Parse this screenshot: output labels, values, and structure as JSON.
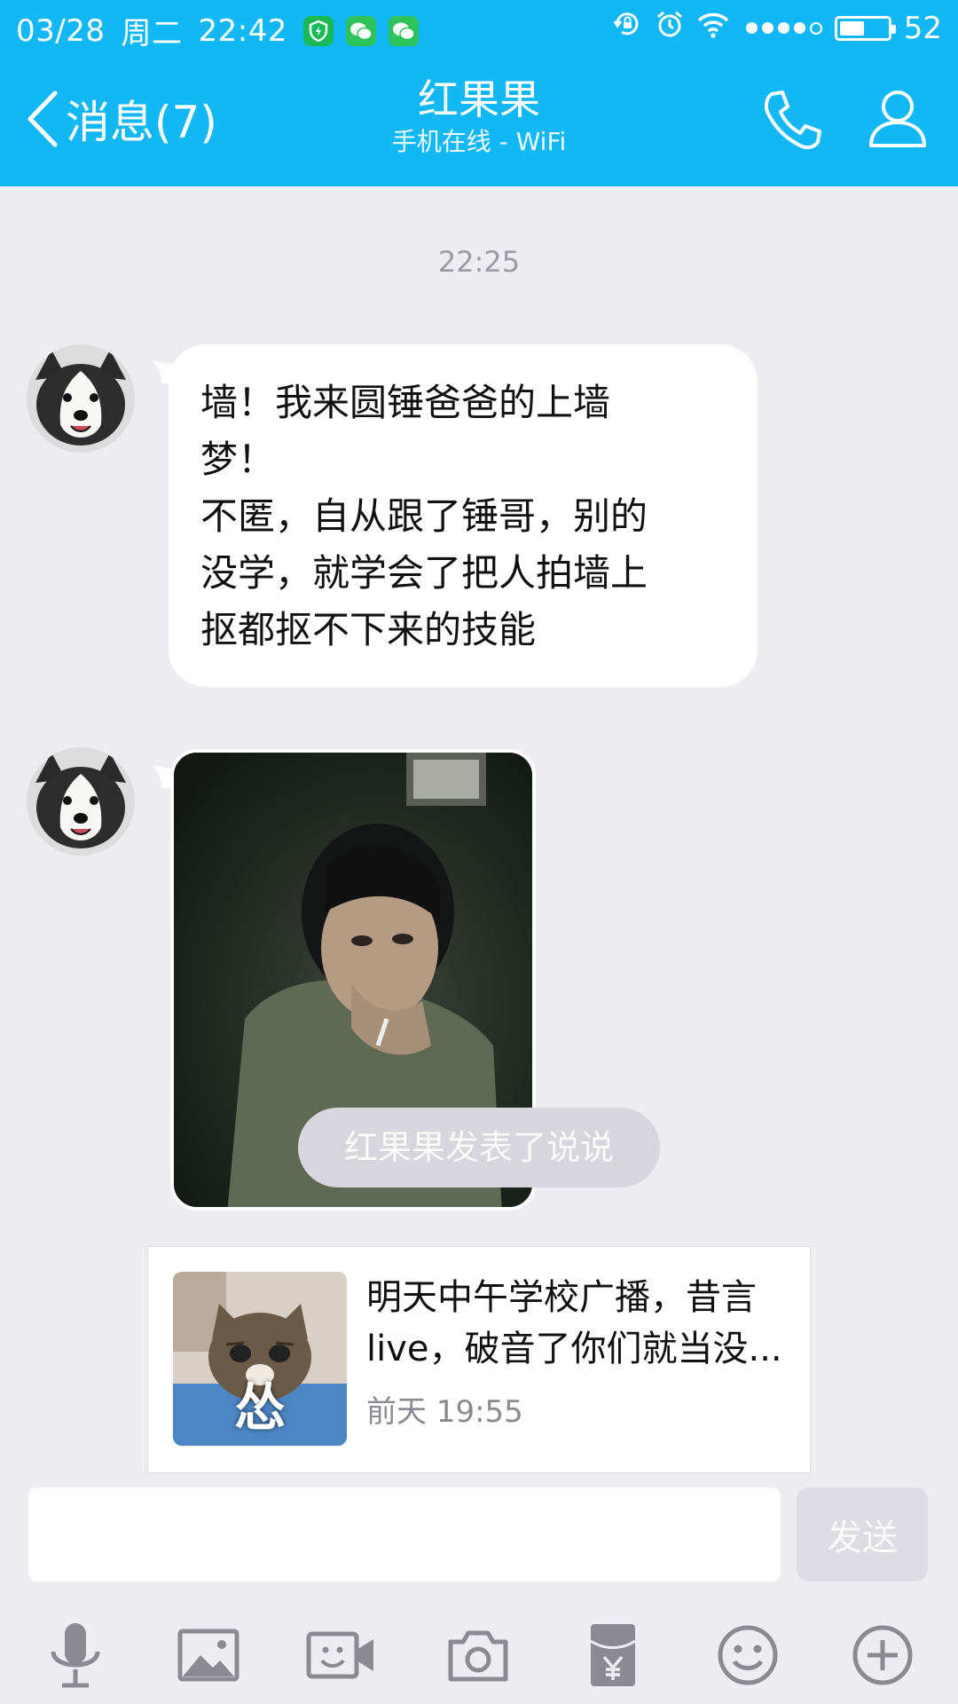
{
  "status_bar": {
    "date": "03/28",
    "weekday": "周二",
    "time": "22:42",
    "battery_percent": "52",
    "battery_level": 0.52,
    "signal_filled": 4,
    "signal_total": 5,
    "app_icons": [
      "security-shield-icon",
      "wechat-icon",
      "wechat-icon"
    ],
    "system_icons": [
      "rotation-lock-icon",
      "alarm-icon",
      "wifi-icon"
    ]
  },
  "nav": {
    "back_label": "消息(7)",
    "title": "红果果",
    "subtitle": "手机在线 - WiFi",
    "accent_color": "#12b7f5"
  },
  "chat": {
    "timestamp": "22:25",
    "text_message": {
      "lines": [
        "墙！我来圆锤爸爸的上墙",
        "梦！",
        "不匿，自从跟了锤哥，别的",
        "没学，就学会了把人拍墙上",
        "抠都抠不下来的技能"
      ]
    },
    "notice": "红果果发表了说说",
    "share_card": {
      "thumb_char": "怂",
      "text_line1": "明天中午学校广播，昔言",
      "text_line2": "live，破音了你们就当没...",
      "time": "前天 19:55"
    }
  },
  "input": {
    "placeholder": "",
    "send_label": "发送"
  },
  "toolbar": {
    "icons": [
      "microphone-icon",
      "image-icon",
      "video-call-icon",
      "camera-icon",
      "red-packet-icon",
      "emoji-icon",
      "plus-icon"
    ]
  }
}
